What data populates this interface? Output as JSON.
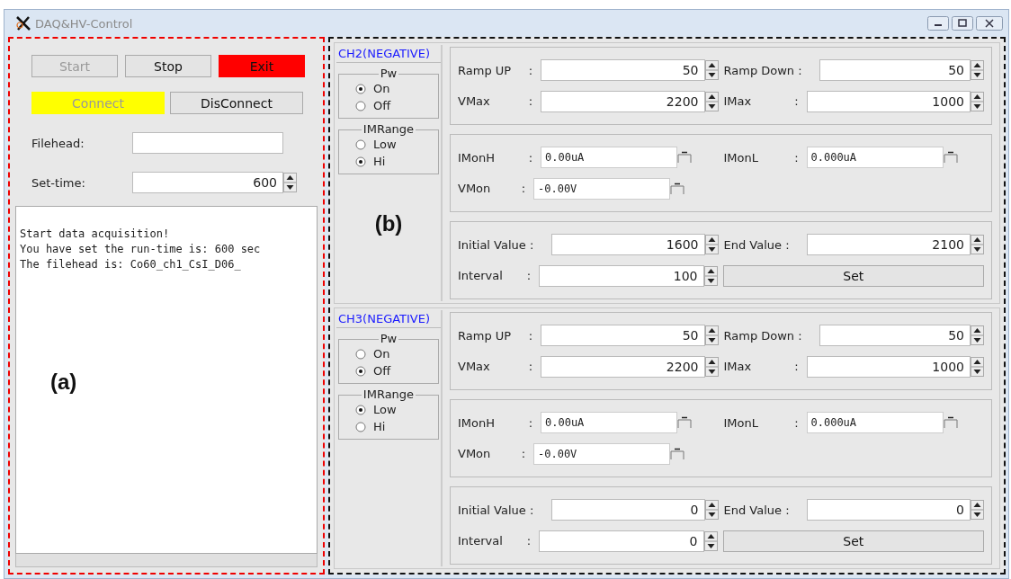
{
  "window": {
    "title": "DAQ&HV-Control"
  },
  "daq_panel": {
    "annotation": "(a)",
    "buttons": [
      {
        "label": "Start",
        "disabled": true
      },
      {
        "label": "Stop",
        "disabled": false
      },
      {
        "label": "Exit",
        "disabled": false,
        "color": "#ff0000"
      },
      {
        "label": "Connect",
        "disabled": true,
        "color": "#ffff00"
      },
      {
        "label": "DisConnect",
        "disabled": false
      }
    ],
    "filehead": {
      "label": "Filehead:"
    },
    "set_time": {
      "label": "Set-time:",
      "value": "600"
    },
    "log": [
      "Start data acquisition!",
      "You have set the run-time is: 600 sec",
      "The filehead is: Co60_ch1_CsI_D06_"
    ]
  },
  "hv_panel": {
    "annotation": "(b)",
    "channels": [
      {
        "title": "CH2(NEGATIVE)",
        "pw": {
          "label": "Pw",
          "options": [
            {
              "label": "On",
              "selected": true
            },
            {
              "label": "Off",
              "selected": false
            }
          ]
        },
        "imrange": {
          "label": "IMRange",
          "options": [
            {
              "label": "Low",
              "selected": false
            },
            {
              "label": "Hi",
              "selected": true
            }
          ]
        },
        "settings": [
          {
            "label": "Ramp UP",
            "sep": ":",
            "value": "50"
          },
          {
            "label": "Ramp Down :",
            "value": "50"
          },
          {
            "label": "VMax",
            "sep": ":",
            "value": "2200"
          },
          {
            "label": "IMax",
            "sep": ":",
            "value": "1000"
          }
        ],
        "monitors": [
          {
            "label": "IMonH",
            "sep": ":",
            "value": "0.00uA"
          },
          {
            "label": "IMonL",
            "sep": ":",
            "value": "0.000uA"
          },
          {
            "label": "VMon",
            "sep": ":",
            "value": "-0.00V"
          }
        ],
        "scan": [
          {
            "label": "Initial Value :",
            "value": "1600"
          },
          {
            "label": "End Value :",
            "value": "2100"
          },
          {
            "label": "Interval",
            "sep": ":",
            "value": "100"
          }
        ],
        "set_button": "Set"
      },
      {
        "title": "CH3(NEGATIVE)",
        "pw": {
          "label": "Pw",
          "options": [
            {
              "label": "On",
              "selected": false
            },
            {
              "label": "Off",
              "selected": true
            }
          ]
        },
        "imrange": {
          "label": "IMRange",
          "options": [
            {
              "label": "Low",
              "selected": true
            },
            {
              "label": "Hi",
              "selected": false
            }
          ]
        },
        "settings": [
          {
            "label": "Ramp UP",
            "sep": ":",
            "value": "50"
          },
          {
            "label": "Ramp Down :",
            "value": "50"
          },
          {
            "label": "VMax",
            "sep": ":",
            "value": "2200"
          },
          {
            "label": "IMax",
            "sep": ":",
            "value": "1000"
          }
        ],
        "monitors": [
          {
            "label": "IMonH",
            "sep": ":",
            "value": "0.00uA"
          },
          {
            "label": "IMonL",
            "sep": ":",
            "value": "0.000uA"
          },
          {
            "label": "VMon",
            "sep": ":",
            "value": "-0.00V"
          }
        ],
        "scan": [
          {
            "label": "Initial Value :",
            "value": "0"
          },
          {
            "label": "End Value :",
            "value": "0"
          },
          {
            "label": "Interval",
            "sep": ":",
            "value": "0"
          }
        ],
        "set_button": "Set"
      }
    ]
  }
}
